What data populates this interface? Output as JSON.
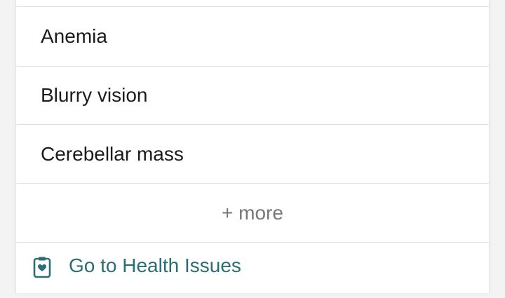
{
  "health_list": {
    "items": [
      {
        "label": "Anemia"
      },
      {
        "label": "Blurry vision"
      },
      {
        "label": "Cerebellar mass"
      }
    ],
    "more_label": "+ more"
  },
  "footer": {
    "link_label": "Go to Health Issues",
    "icon": "clipboard-heart-icon",
    "accent_color": "#2b6f74"
  }
}
